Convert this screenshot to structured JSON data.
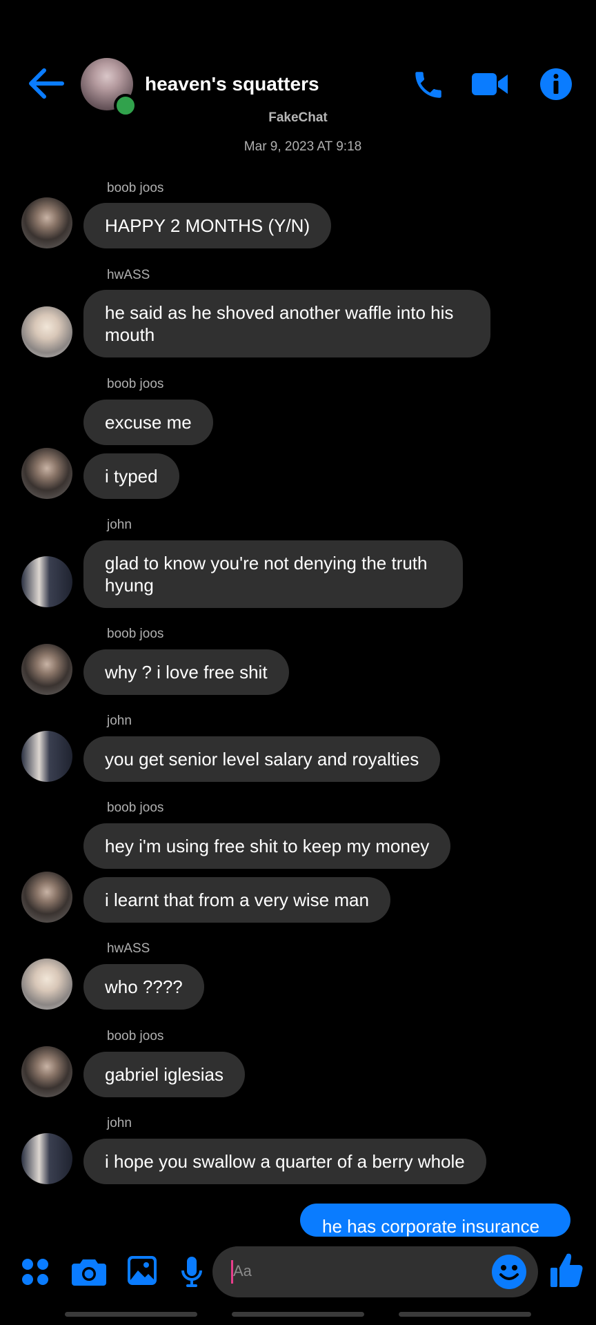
{
  "header": {
    "title": "heaven's squatters",
    "watermark": "FakeChat",
    "date": "Mar 9, 2023 AT 9:18",
    "accent_color": "#0a7cff",
    "icons": [
      "back-arrow-icon",
      "phone-icon",
      "video-camera-icon",
      "info-icon"
    ]
  },
  "messages": [
    {
      "sender": "boob joos",
      "text": "HAPPY 2 MONTHS (Y/N)"
    },
    {
      "sender": "hwASS",
      "text": "he said as he shoved another waffle into his mouth"
    },
    {
      "sender": "boob joos",
      "text": "excuse me"
    },
    {
      "text": "i typed"
    },
    {
      "sender": "john",
      "text": "glad to know you're not denying the truth hyung"
    },
    {
      "sender": "boob joos",
      "text": "why ? i love free shit"
    },
    {
      "sender": "john",
      "text": "you get senior level salary and royalties"
    },
    {
      "sender": "boob joos",
      "text": "hey i'm using free shit to keep my money"
    },
    {
      "text": "i learnt that from a very wise man"
    },
    {
      "sender": "hwASS",
      "text": "who ????"
    },
    {
      "sender": "boob joos",
      "text": "gabriel iglesias"
    },
    {
      "sender": "john",
      "text": "i hope you swallow a quarter of a berry whole"
    }
  ],
  "outgoing": {
    "text": "he has corporate insurance"
  },
  "composer": {
    "placeholder": "Aa",
    "icons": [
      "apps-grid-icon",
      "camera-icon",
      "image-icon",
      "microphone-icon",
      "emoji-icon",
      "thumbs-up-icon"
    ]
  }
}
